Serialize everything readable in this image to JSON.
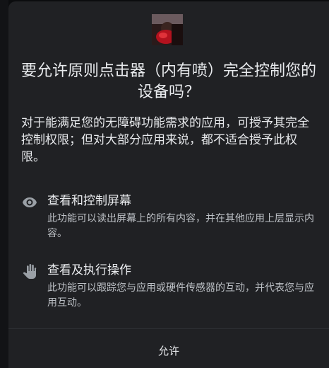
{
  "dialog": {
    "title": "要允许原则点击器（内有喷）完全控制您的设备吗？",
    "description": "对于能满足您的无障碍功能需求的应用，可授予其完全控制权限；但对大部分应用来说，都不适合授予此权限。",
    "permissions": [
      {
        "icon": "eye-icon",
        "title": "查看和控制屏幕",
        "description": "此功能可以读出屏幕上的所有内容，并在其他应用上层显示内容。"
      },
      {
        "icon": "hand-icon",
        "title": "查看及执行操作",
        "description": "此功能可以跟踪您与应用或硬件传感器的互动，并代表您与应用互动。"
      }
    ],
    "allow_label": "允许"
  },
  "colors": {
    "dialog_bg": "#202124",
    "backdrop": "#0b0c0e",
    "primary_text": "#e8eaed",
    "secondary_text": "#bdc1c6",
    "icon": "#9aa0a6"
  }
}
